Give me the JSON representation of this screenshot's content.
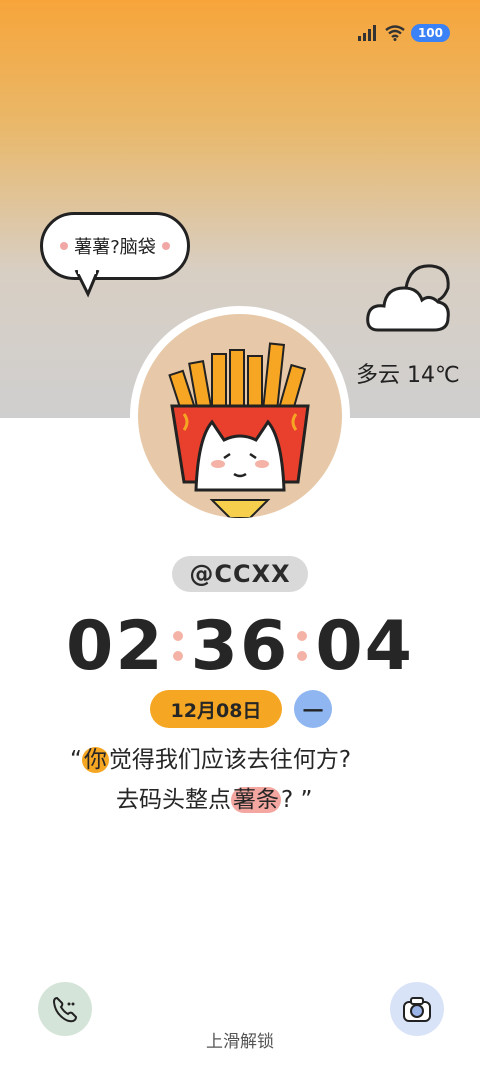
{
  "status_bar": {
    "battery": "100",
    "icons": [
      "signal-icon",
      "wifi-icon"
    ]
  },
  "bubble": {
    "text": "薯薯?脑袋"
  },
  "weather": {
    "text": "多云 14℃",
    "icon": "cloud-icon"
  },
  "profile": {
    "username": "@CCXX",
    "avatar_icon": "cat-fries-avatar"
  },
  "clock": {
    "hours": "02",
    "minutes": "36",
    "seconds": "04"
  },
  "date": {
    "text": "12月08日",
    "weekday": "一"
  },
  "quote": {
    "open_mark": "“",
    "l1_hl": "你",
    "l1_rest": "觉得我们应该去往何方?",
    "l2_pre": "去码头整点",
    "l2_hl": "薯条",
    "l2_post": "? ”"
  },
  "shortcuts": {
    "left_icon": "phone-icon",
    "right_icon": "camera-icon"
  },
  "unlock": {
    "text": "上滑解锁"
  },
  "colors": {
    "accent_orange": "#f5a623",
    "accent_pink": "#f4a7a0",
    "accent_blue": "#8fb6f0"
  }
}
